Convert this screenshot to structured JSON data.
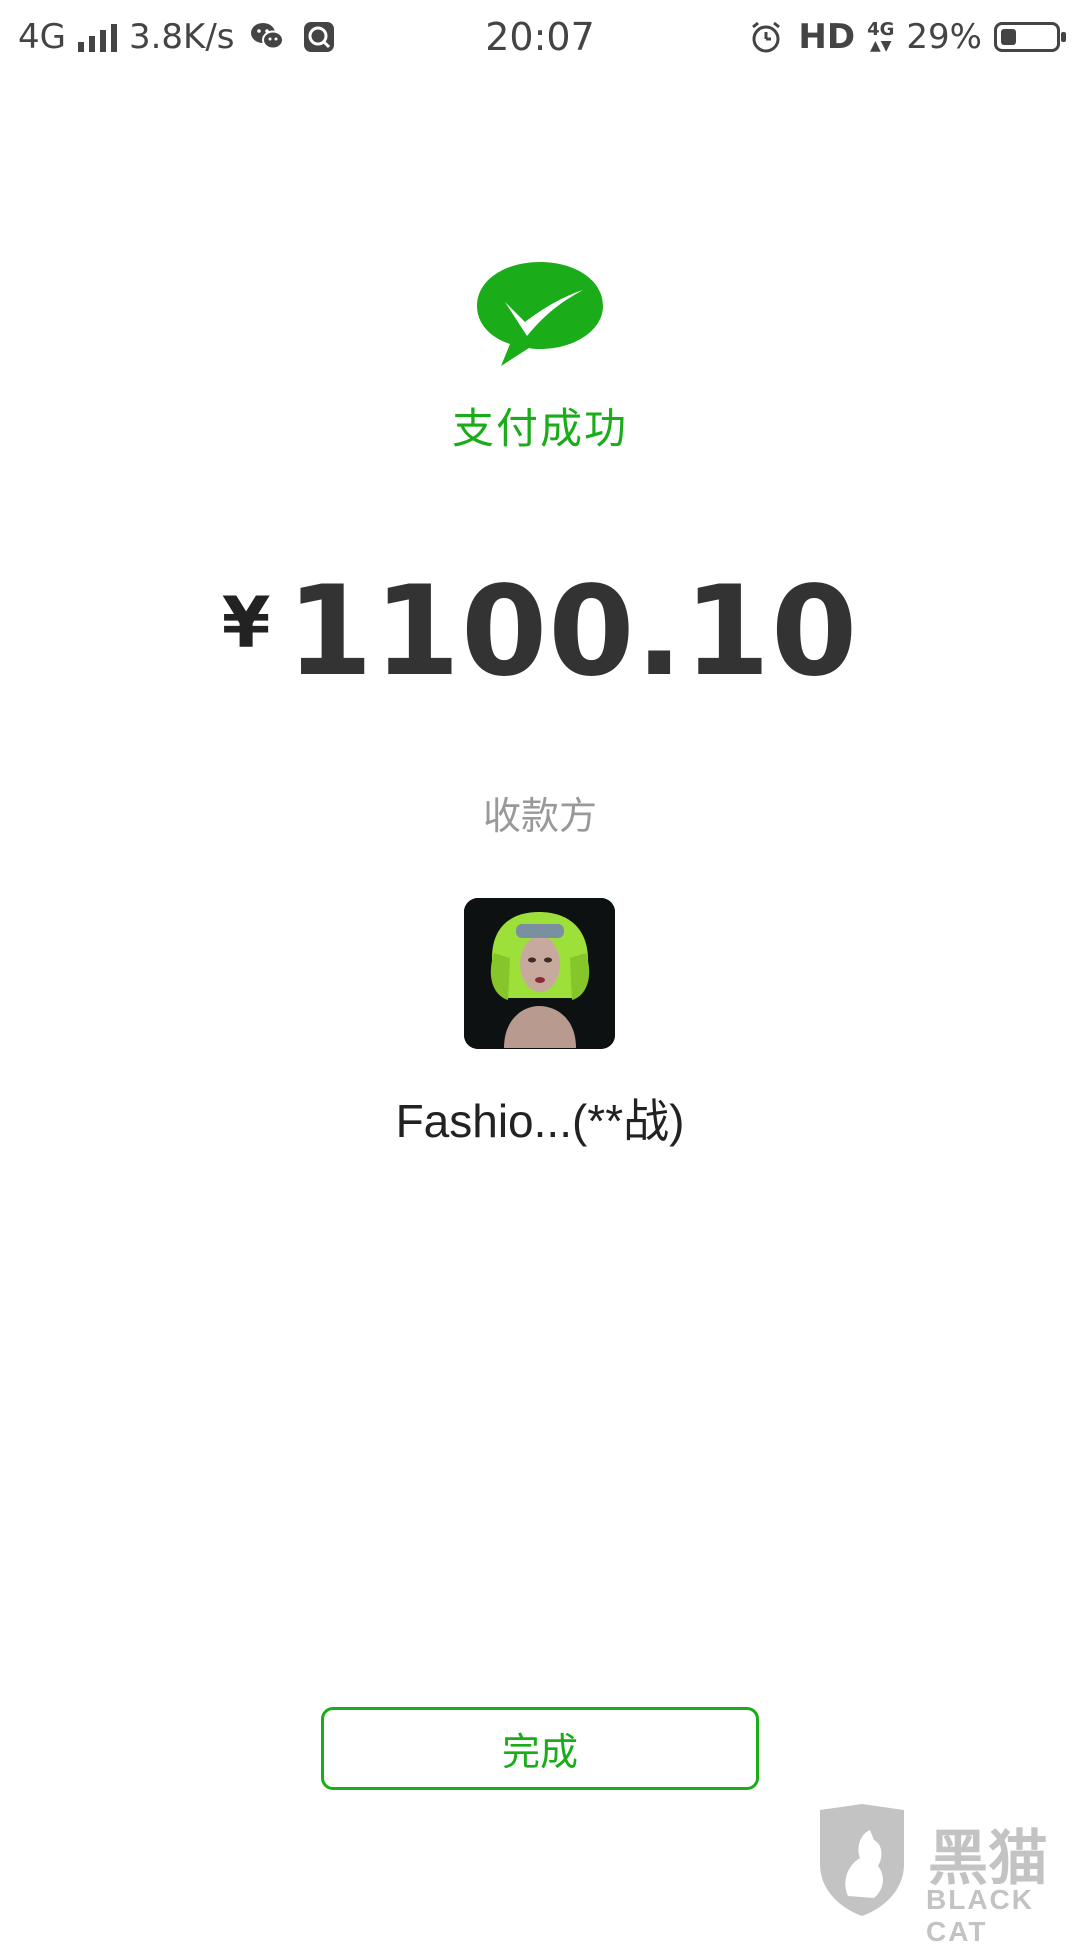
{
  "status_bar": {
    "network": "4G",
    "speed": "3.8K/s",
    "time": "20:07",
    "hd": "HD",
    "network_right": "4G",
    "battery_percent": "29%",
    "battery_level": 0.29,
    "icons": [
      "signal-icon",
      "wechat-icon",
      "search-app-icon",
      "alarm-icon",
      "data-arrows-icon",
      "battery-icon"
    ]
  },
  "payment": {
    "status": "支付成功",
    "currency_symbol": "¥",
    "amount": "1100.10",
    "payee_label": "收款方",
    "payee_name": "Fashio...(**战)"
  },
  "actions": {
    "done_label": "完成"
  },
  "watermark": {
    "brand": "黑猫",
    "brand_en": "BLACK CAT"
  },
  "colors": {
    "accent": "#1aad19",
    "text": "#333333",
    "muted": "#999999"
  }
}
